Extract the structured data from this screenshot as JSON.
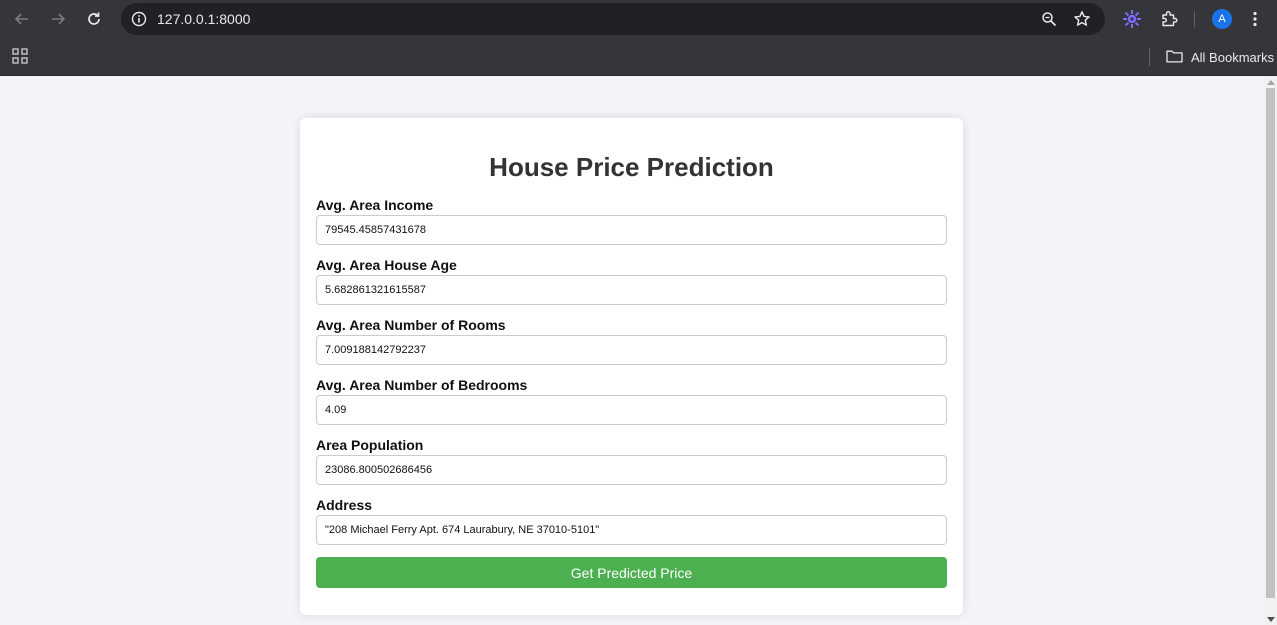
{
  "browser": {
    "url": "127.0.0.1:8000",
    "profile_initial": "A",
    "bookmarks_label": "All Bookmarks",
    "accent_color": "#1a73e8"
  },
  "page": {
    "title": "House Price Prediction",
    "fields": [
      {
        "label": "Avg. Area Income",
        "value": "79545.45857431678"
      },
      {
        "label": "Avg. Area House Age",
        "value": "5.682861321615587"
      },
      {
        "label": "Avg. Area Number of Rooms",
        "value": "7.009188142792237"
      },
      {
        "label": "Avg. Area Number of Bedrooms",
        "value": "4.09"
      },
      {
        "label": "Area Population",
        "value": "23086.800502686456"
      },
      {
        "label": "Address",
        "value": "\"208 Michael Ferry Apt. 674 Laurabury, NE 37010-5101\""
      }
    ],
    "submit_label": "Get Predicted Price",
    "button_color": "#4caf50"
  }
}
